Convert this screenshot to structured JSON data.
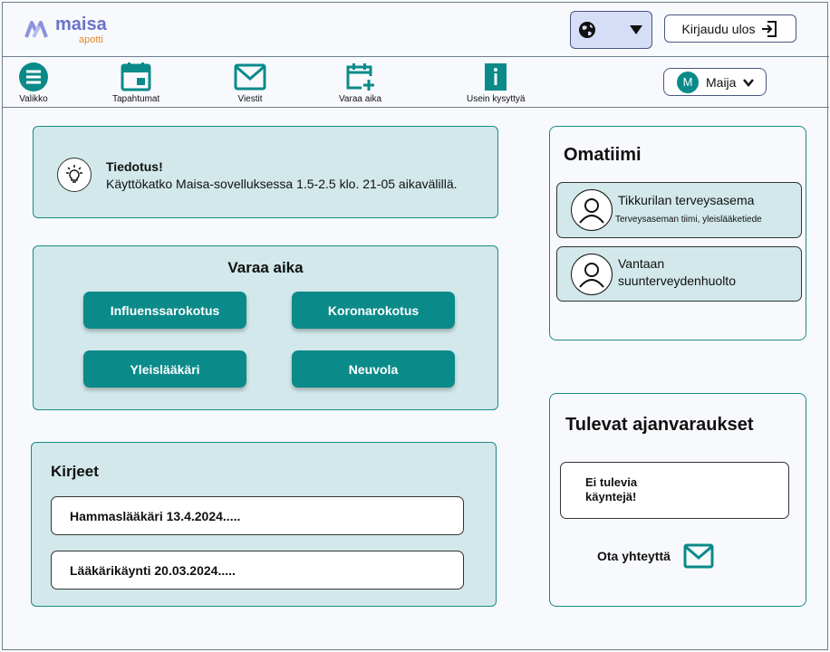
{
  "brand": {
    "name": "maisa",
    "sub": "apotti",
    "primary_color": "#0b8a8a",
    "logo_color": "#6a73c8",
    "sub_color": "#e58a2b"
  },
  "header": {
    "language_icon": "globe-icon",
    "logout_label": "Kirjaudu ulos",
    "logout_icon": "sign-out-icon"
  },
  "nav": {
    "items": [
      {
        "label": "Valikko",
        "icon": "menu-icon"
      },
      {
        "label": "Tapahtumat",
        "icon": "calendar-icon"
      },
      {
        "label": "Viestit",
        "icon": "mail-icon"
      },
      {
        "label": "Varaa aika",
        "icon": "calendar-plus-icon"
      },
      {
        "label": "Usein kysyttyä",
        "icon": "info-icon"
      }
    ],
    "user": {
      "initial": "M",
      "name": "Maija"
    }
  },
  "notice": {
    "title": "Tiedotus!",
    "text": "Käyttökatko Maisa-sovelluksessa 1.5-2.5 klo. 21-05 aikavälillä.",
    "icon": "lightbulb-icon"
  },
  "booking": {
    "title": "Varaa aika",
    "buttons": [
      "Influenssarokotus",
      "Koronarokotus",
      "Yleislääkäri",
      "Neuvola"
    ]
  },
  "letters": {
    "title": "Kirjeet",
    "items": [
      "Hammaslääkäri 13.4.2024.....",
      "Lääkärikäynti 20.03.2024....."
    ]
  },
  "team": {
    "title": "Omatiimi",
    "items": [
      {
        "name": "Tikkurilan terveysasema",
        "sub": "Terveysaseman tiimi, yleislääketiede"
      },
      {
        "name_line1": "Vantaan",
        "name_line2": "suunterveydenhuolto"
      }
    ]
  },
  "upcoming": {
    "title": "Tulevat ajanvaraukset",
    "empty_line1": "Ei tulevia",
    "empty_line2": "käyntejä!",
    "contact_label": "Ota yhteyttä",
    "contact_icon": "mail-icon"
  }
}
